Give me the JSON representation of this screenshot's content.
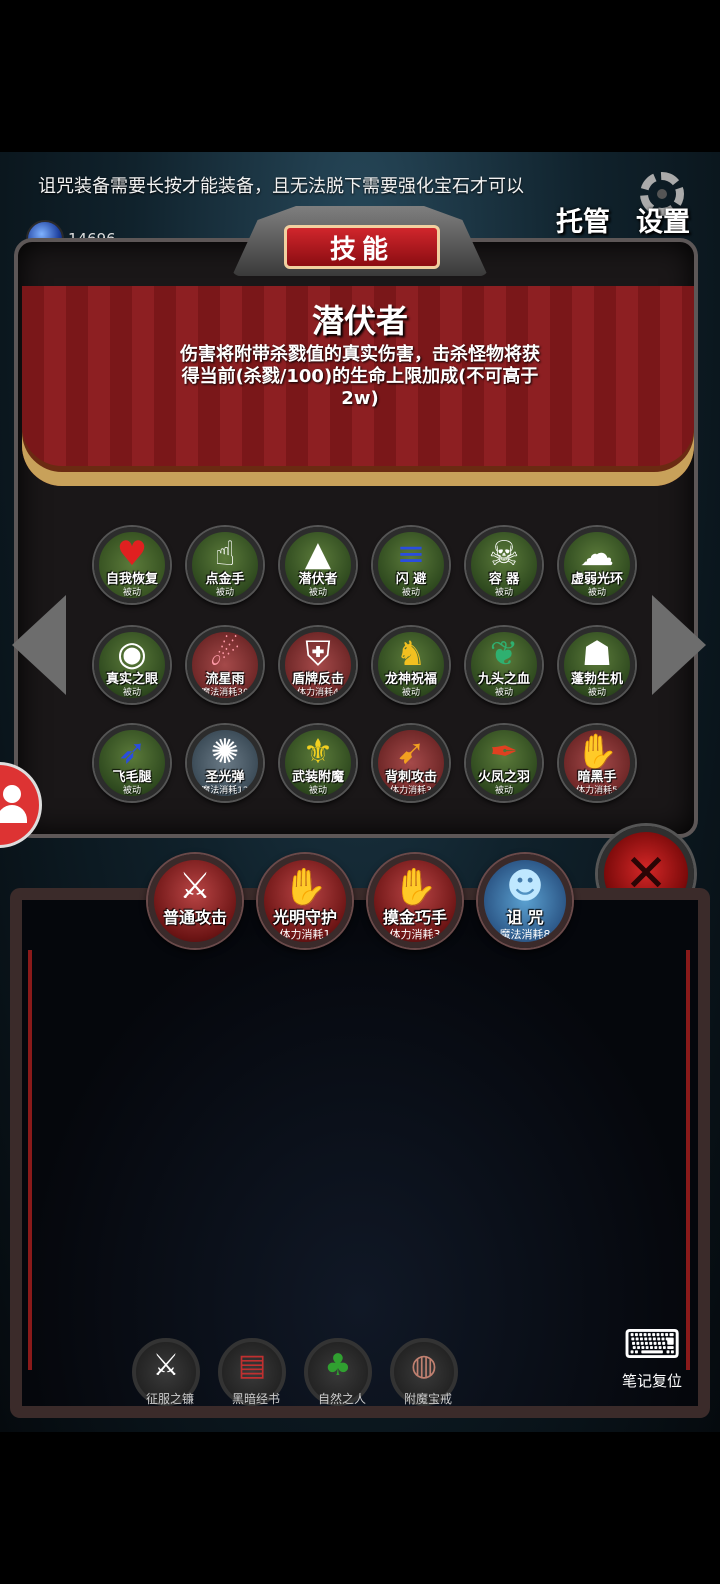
{
  "ticker_text": "诅咒装备需要长按才能装备，且无法脱下需要强化宝石才可以",
  "gem_count": "14696",
  "top_buttons": {
    "auto": "托管",
    "settings": "设置"
  },
  "banner_title": "技能",
  "selected_skill": {
    "name": "潜伏者",
    "description": "伤害将附带杀戮值的真实伤害，击杀怪物将获得当前(杀戮/100)的生命上限加成(不可高于2w)"
  },
  "skills": [
    {
      "name": "自我恢复",
      "sub": "被动",
      "icon": "heart-icon"
    },
    {
      "name": "点金手",
      "sub": "被动",
      "icon": "pointing-hand-icon"
    },
    {
      "name": "潜伏者",
      "sub": "被动",
      "icon": "hood-icon"
    },
    {
      "name": "闪 避",
      "sub": "被动",
      "icon": "dodge-icon"
    },
    {
      "name": "容 器",
      "sub": "被动",
      "icon": "skull-horns-icon"
    },
    {
      "name": "虚弱光环",
      "sub": "被动",
      "icon": "ghost-icon"
    },
    {
      "name": "真实之眼",
      "sub": "被动",
      "icon": "eye-icon"
    },
    {
      "name": "流星雨",
      "sub": "魔法消耗30",
      "icon": "meteor-icon"
    },
    {
      "name": "盾牌反击",
      "sub": "体力消耗4",
      "icon": "shield-icon"
    },
    {
      "name": "龙神祝福",
      "sub": "被动",
      "icon": "dragon-icon"
    },
    {
      "name": "九头之血",
      "sub": "被动",
      "icon": "hydra-icon"
    },
    {
      "name": "蓬勃生机",
      "sub": "被动",
      "icon": "vitality-icon"
    },
    {
      "name": "飞毛腿",
      "sub": "被动",
      "icon": "runner-icon"
    },
    {
      "name": "圣光弹",
      "sub": "魔法消耗12",
      "icon": "holy-burst-icon"
    },
    {
      "name": "武装附魔",
      "sub": "被动",
      "icon": "wings-icon"
    },
    {
      "name": "背刺攻击",
      "sub": "体力消耗3",
      "icon": "backstab-icon"
    },
    {
      "name": "火凤之羽",
      "sub": "被动",
      "icon": "feather-icon"
    },
    {
      "name": "暗黑手",
      "sub": "体力消耗5",
      "icon": "dark-hand-icon"
    }
  ],
  "battle_skills": [
    {
      "name": "普通攻击",
      "sub": "",
      "icon": "sword-icon"
    },
    {
      "name": "光明守护",
      "sub": "体力消耗1",
      "icon": "light-hand-icon"
    },
    {
      "name": "摸金巧手",
      "sub": "体力消耗3",
      "icon": "grab-hand-icon"
    },
    {
      "name": "诅 咒",
      "sub": "魔法消耗8",
      "icon": "curse-mask-icon"
    }
  ],
  "bottom_items": [
    {
      "name": "征服之镰",
      "icon": "scythe-icon"
    },
    {
      "name": "黑暗经书",
      "icon": "book-icon"
    },
    {
      "name": "自然之人",
      "icon": "nature-man-icon"
    },
    {
      "name": "附魔宝戒",
      "icon": "ring-icon"
    }
  ],
  "note_reset": "笔记复位"
}
